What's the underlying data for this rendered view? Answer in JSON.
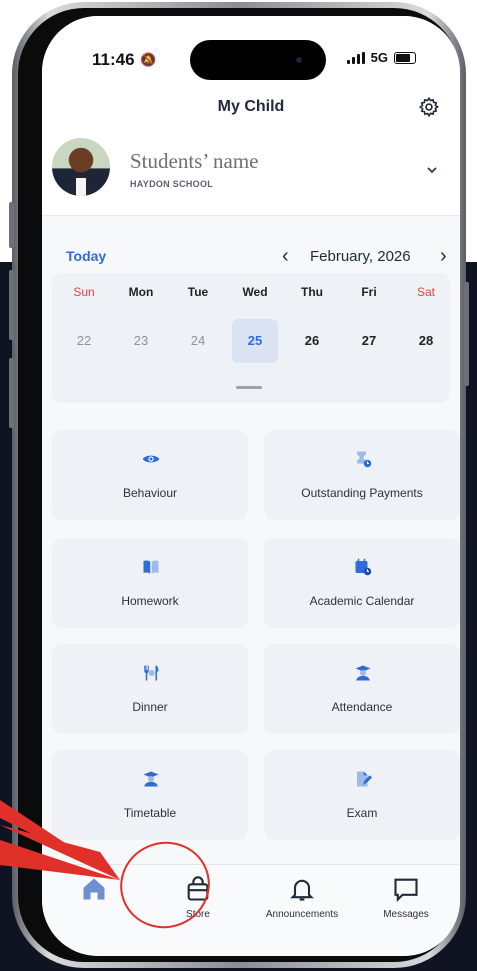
{
  "status_bar": {
    "time": "11:46",
    "network": "5G"
  },
  "header": {
    "title": "My Child"
  },
  "student": {
    "name": "Students’ name",
    "school": "HAYDON SCHOOL"
  },
  "calendar": {
    "today_label": "Today",
    "month": "February, 2026",
    "days": [
      {
        "dow": "Sun",
        "num": "22"
      },
      {
        "dow": "Mon",
        "num": "23"
      },
      {
        "dow": "Tue",
        "num": "24"
      },
      {
        "dow": "Wed",
        "num": "25"
      },
      {
        "dow": "Thu",
        "num": "26"
      },
      {
        "dow": "Fri",
        "num": "27"
      },
      {
        "dow": "Sat",
        "num": "28"
      }
    ],
    "selected": "25"
  },
  "tiles": [
    {
      "label": "Behaviour",
      "icon": "eye-icon"
    },
    {
      "label": "Outstanding Payments",
      "icon": "hourglass-icon"
    },
    {
      "label": "Homework",
      "icon": "book-icon"
    },
    {
      "label": "Academic Calendar",
      "icon": "calendar-icon"
    },
    {
      "label": "Dinner",
      "icon": "cutlery-icon"
    },
    {
      "label": "Attendance",
      "icon": "graduate-icon"
    },
    {
      "label": "Timetable",
      "icon": "graduate-icon"
    },
    {
      "label": "Exam",
      "icon": "document-icon"
    }
  ],
  "bottom_nav": [
    {
      "label": "Store",
      "icon": "bag-icon"
    },
    {
      "label": "Announcements",
      "icon": "bell-icon"
    },
    {
      "label": "Messages",
      "icon": "chat-icon"
    }
  ],
  "colors": {
    "accent": "#2f6cd8",
    "weekend": "#e0453a",
    "annotation": "#e0302a"
  }
}
